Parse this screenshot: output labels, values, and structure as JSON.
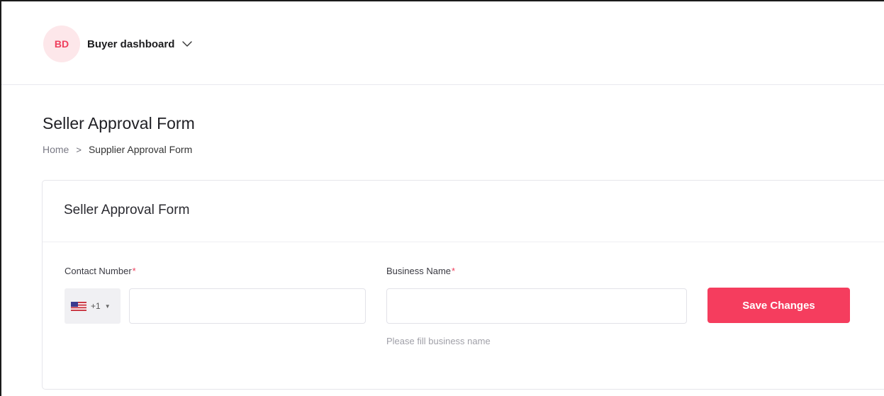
{
  "header": {
    "avatar_initials": "BD",
    "dashboard_label": "Buyer dashboard",
    "chevron_icon": "chevron-down-icon"
  },
  "page": {
    "title": "Seller Approval Form",
    "breadcrumb": {
      "home": "Home",
      "separator": ">",
      "current": "Supplier Approval Form"
    }
  },
  "form": {
    "title": "Seller Approval Form",
    "contact": {
      "label": "Contact Number",
      "required_mark": "*",
      "country_code": "+1",
      "flag_icon": "us-flag-icon",
      "value": "",
      "placeholder": ""
    },
    "business": {
      "label": "Business Name",
      "required_mark": "*",
      "value": "",
      "placeholder": "",
      "helper": "Please fill business name"
    },
    "save_label": "Save Changes"
  },
  "colors": {
    "accent": "#f53d5e",
    "avatar_bg": "#fde7ea",
    "avatar_text": "#ef3e5c"
  }
}
